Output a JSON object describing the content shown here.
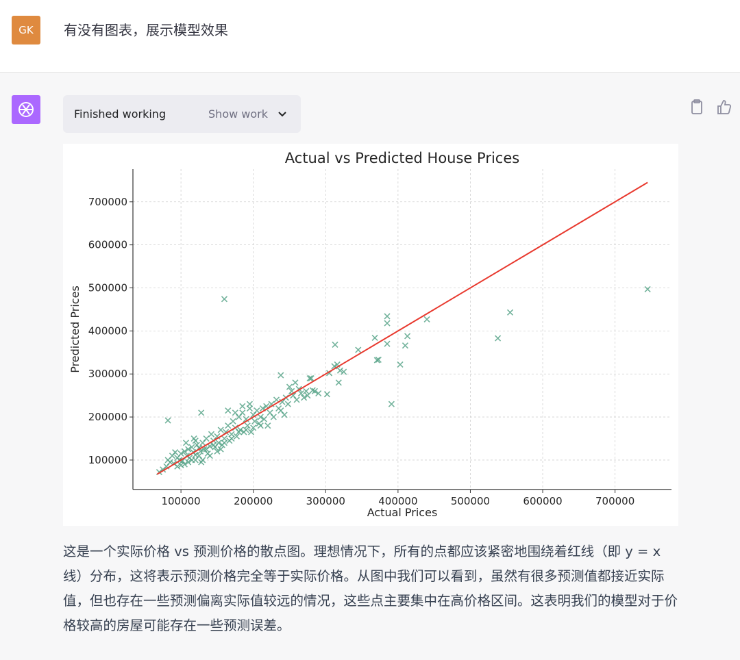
{
  "user": {
    "avatar_initials": "GK",
    "avatar_color": "#df8a3f",
    "message": "有没有图表，展示模型效果"
  },
  "assistant": {
    "avatar_icon": "openai-logo-icon",
    "avatar_color": "#ab68ff",
    "status_label": "Finished working",
    "show_work_label": "Show work",
    "actions": [
      "clipboard-icon",
      "thumbs-up-icon"
    ],
    "response": "这是一个实际价格 vs 预测价格的散点图。理想情况下，所有的点都应该紧密地围绕着红线（即 y = x 线）分布，这将表示预测价格完全等于实际价格。从图中我们可以看到，虽然有很多预测值都接近实际值，但也存在一些预测偏离实际值较远的情况，这些点主要集中在高价格区间。这表明我们的模型对于价格较高的房屋可能存在一些预测误差。"
  },
  "chart_data": {
    "type": "scatter",
    "title": "Actual vs Predicted House Prices",
    "xlabel": "Actual Prices",
    "ylabel": "Predicted Prices",
    "xlim": [
      33600,
      778000
    ],
    "ylim": [
      31500,
      776000
    ],
    "xticks": [
      100000,
      200000,
      300000,
      400000,
      500000,
      600000,
      700000
    ],
    "yticks": [
      100000,
      200000,
      300000,
      400000,
      500000,
      600000,
      700000
    ],
    "grid": true,
    "marker": "x",
    "marker_color": "#4f9f82",
    "reference_line": {
      "type": "y=x",
      "from": 67000,
      "to": 745000,
      "color": "#e8392e"
    },
    "points": [
      [
        160000,
        474000
      ],
      [
        745000,
        497000
      ],
      [
        555000,
        443000
      ],
      [
        538000,
        383000
      ],
      [
        440000,
        427000
      ],
      [
        385000,
        434000
      ],
      [
        385000,
        418000
      ],
      [
        368000,
        384000
      ],
      [
        413000,
        388000
      ],
      [
        410000,
        366000
      ],
      [
        345000,
        356000
      ],
      [
        403000,
        322000
      ],
      [
        391000,
        230000
      ],
      [
        371000,
        332000
      ],
      [
        373000,
        333000
      ],
      [
        313000,
        368000
      ],
      [
        385000,
        370000
      ],
      [
        316000,
        322000
      ],
      [
        320000,
        308000
      ],
      [
        318000,
        280000
      ],
      [
        302000,
        253000
      ],
      [
        238000,
        297000
      ],
      [
        82000,
        192000
      ],
      [
        128000,
        210000
      ],
      [
        325000,
        305000
      ],
      [
        305000,
        302000
      ],
      [
        280000,
        290000
      ],
      [
        285000,
        260000
      ],
      [
        275000,
        250000
      ],
      [
        312000,
        318000
      ],
      [
        70000,
        72000
      ],
      [
        75000,
        78000
      ],
      [
        80000,
        85000
      ],
      [
        82000,
        100000
      ],
      [
        85000,
        95000
      ],
      [
        88000,
        110000
      ],
      [
        90000,
        92000
      ],
      [
        92000,
        118000
      ],
      [
        95000,
        105000
      ],
      [
        98000,
        100000
      ],
      [
        100000,
        115000
      ],
      [
        102000,
        98000
      ],
      [
        105000,
        120000
      ],
      [
        107000,
        140000
      ],
      [
        108000,
        110000
      ],
      [
        110000,
        125000
      ],
      [
        112000,
        105000
      ],
      [
        115000,
        130000
      ],
      [
        117000,
        118000
      ],
      [
        118000,
        150000
      ],
      [
        120000,
        112000
      ],
      [
        122000,
        135000
      ],
      [
        125000,
        128000
      ],
      [
        127000,
        120000
      ],
      [
        130000,
        140000
      ],
      [
        132000,
        125000
      ],
      [
        135000,
        150000
      ],
      [
        137000,
        115000
      ],
      [
        140000,
        132000
      ],
      [
        142000,
        160000
      ],
      [
        145000,
        145000
      ],
      [
        147000,
        130000
      ],
      [
        150000,
        155000
      ],
      [
        152000,
        140000
      ],
      [
        155000,
        170000
      ],
      [
        157000,
        135000
      ],
      [
        160000,
        150000
      ],
      [
        162000,
        165000
      ],
      [
        165000,
        180000
      ],
      [
        167000,
        145000
      ],
      [
        170000,
        160000
      ],
      [
        172000,
        190000
      ],
      [
        175000,
        175000
      ],
      [
        177000,
        155000
      ],
      [
        180000,
        200000
      ],
      [
        182000,
        170000
      ],
      [
        185000,
        210000
      ],
      [
        187000,
        165000
      ],
      [
        190000,
        195000
      ],
      [
        192000,
        180000
      ],
      [
        195000,
        220000
      ],
      [
        197000,
        165000
      ],
      [
        200000,
        205000
      ],
      [
        202000,
        190000
      ],
      [
        205000,
        215000
      ],
      [
        208000,
        185000
      ],
      [
        210000,
        200000
      ],
      [
        213000,
        220000
      ],
      [
        215000,
        195000
      ],
      [
        218000,
        225000
      ],
      [
        220000,
        180000
      ],
      [
        223000,
        210000
      ],
      [
        225000,
        230000
      ],
      [
        228000,
        200000
      ],
      [
        232000,
        240000
      ],
      [
        235000,
        220000
      ],
      [
        238000,
        215000
      ],
      [
        240000,
        235000
      ],
      [
        243000,
        205000
      ],
      [
        245000,
        245000
      ],
      [
        248000,
        230000
      ],
      [
        250000,
        270000
      ],
      [
        253000,
        260000
      ],
      [
        255000,
        250000
      ],
      [
        258000,
        280000
      ],
      [
        260000,
        240000
      ],
      [
        263000,
        265000
      ],
      [
        266000,
        255000
      ],
      [
        270000,
        245000
      ],
      [
        273000,
        260000
      ],
      [
        278000,
        290000
      ],
      [
        282000,
        262000
      ],
      [
        290000,
        255000
      ],
      [
        105000,
        90000
      ],
      [
        115000,
        100000
      ],
      [
        125000,
        110000
      ],
      [
        135000,
        125000
      ],
      [
        145000,
        135000
      ],
      [
        150000,
        120000
      ],
      [
        160000,
        140000
      ],
      [
        170000,
        150000
      ],
      [
        180000,
        165000
      ],
      [
        190000,
        170000
      ],
      [
        200000,
        175000
      ],
      [
        210000,
        180000
      ],
      [
        175000,
        210000
      ],
      [
        185000,
        225000
      ],
      [
        195000,
        230000
      ],
      [
        165000,
        215000
      ],
      [
        130000,
        100000
      ],
      [
        140000,
        110000
      ],
      [
        120000,
        100000
      ],
      [
        100000,
        88000
      ],
      [
        110000,
        95000
      ],
      [
        95000,
        85000
      ],
      [
        155000,
        125000
      ],
      [
        120000,
        145000
      ],
      [
        128000,
        95000
      ]
    ]
  }
}
